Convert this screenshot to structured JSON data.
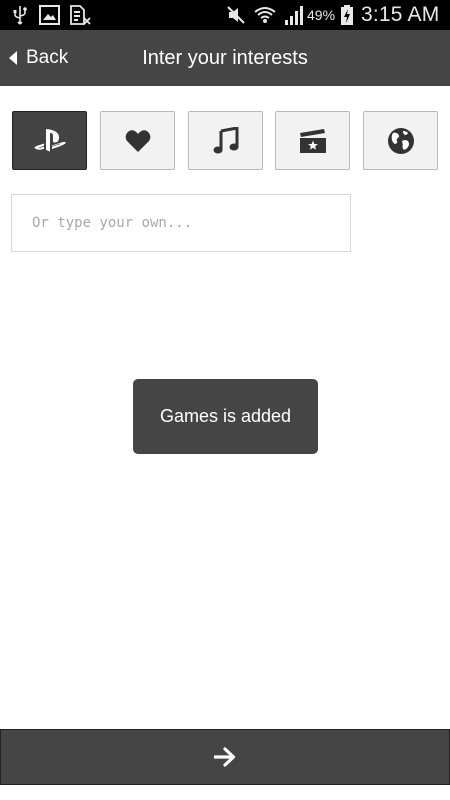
{
  "status_bar": {
    "battery_percent": "49%",
    "time": "3:15 AM",
    "icons": [
      "usb-icon",
      "gallery-icon",
      "sim-error-icon",
      "mute-icon",
      "wifi-icon",
      "signal-icon",
      "battery-charging-icon"
    ]
  },
  "action_bar": {
    "back_label": "Back",
    "title": "Inter your interests"
  },
  "categories": [
    {
      "icon": "playstation-icon",
      "selected": true
    },
    {
      "icon": "heart-icon",
      "selected": false
    },
    {
      "icon": "music-note-icon",
      "selected": false
    },
    {
      "icon": "film-star-icon",
      "selected": false
    },
    {
      "icon": "globe-icon",
      "selected": false
    }
  ],
  "own_interest": {
    "placeholder": "Or type your own...",
    "value": ""
  },
  "toast": {
    "message": "Games is added"
  },
  "next_button": {
    "icon": "arrow-right-icon"
  },
  "colors": {
    "bar_background": "#454545",
    "selected_category": "#434343",
    "category_background": "#f2f2f2",
    "status_bar": "#000000"
  }
}
